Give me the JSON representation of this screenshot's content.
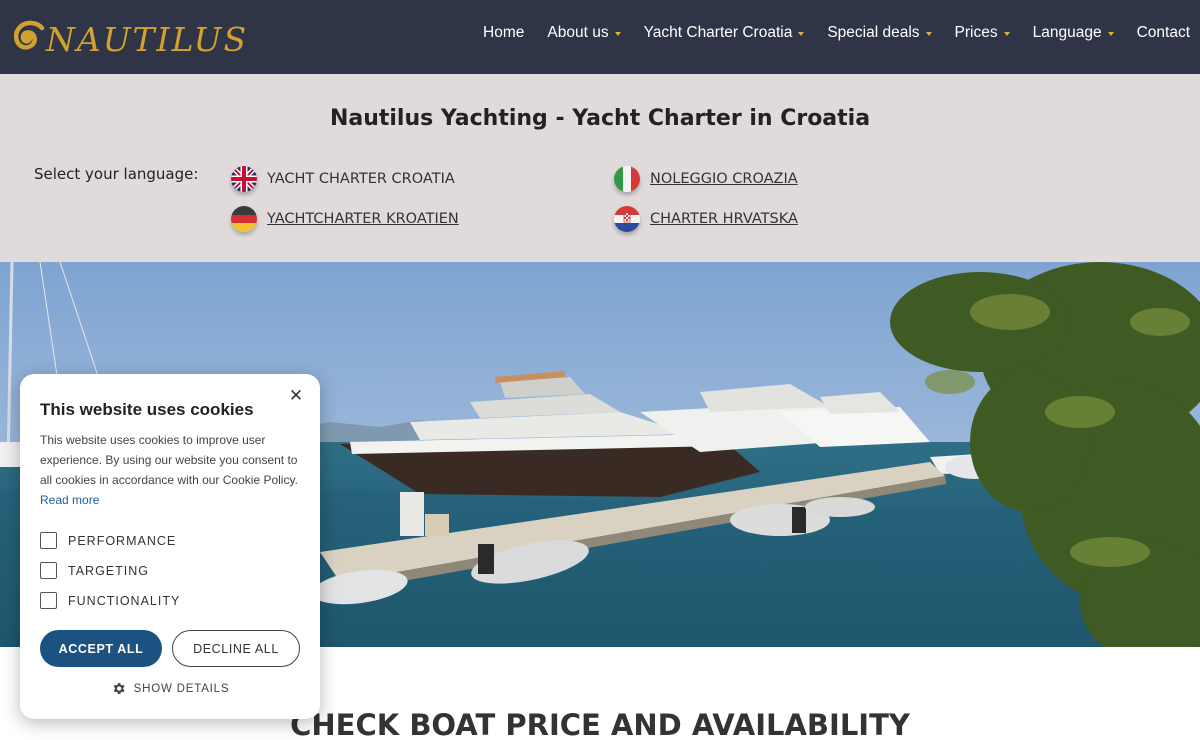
{
  "header": {
    "logo_text": "NAUTILUS",
    "nav": [
      {
        "label": "Home",
        "has_dropdown": false
      },
      {
        "label": "About us",
        "has_dropdown": true
      },
      {
        "label": "Yacht Charter Croatia",
        "has_dropdown": true
      },
      {
        "label": "Special deals",
        "has_dropdown": true
      },
      {
        "label": "Prices",
        "has_dropdown": true
      },
      {
        "label": "Language",
        "has_dropdown": true
      },
      {
        "label": "Contact",
        "has_dropdown": false
      }
    ]
  },
  "language_section": {
    "title": "Nautilus Yachting - Yacht Charter in Croatia",
    "select_label": "Select your language:",
    "languages": [
      {
        "label": "YACHT CHARTER CROATIA",
        "flag": "uk-flag-icon"
      },
      {
        "label": "NOLEGGIO CROAZIA",
        "flag": "italy-flag-icon"
      },
      {
        "label": "YACHTCHARTER KROATIEN",
        "flag": "germany-flag-icon"
      },
      {
        "label": "CHARTER HRVATSKA",
        "flag": "croatia-flag-icon"
      }
    ]
  },
  "hero": {
    "image": "marina-yachts-photo"
  },
  "main": {
    "section_title": "CHECK BOAT PRICE AND AVAILABILITY"
  },
  "cookie_dialog": {
    "title": "This website uses cookies",
    "body": "This website uses cookies to improve user experience. By using our website you consent to all cookies in accordance with our Cookie Policy.",
    "read_more": "Read more",
    "options": [
      "PERFORMANCE",
      "TARGETING",
      "FUNCTIONALITY"
    ],
    "accept_label": "ACCEPT ALL",
    "decline_label": "DECLINE ALL",
    "details_label": "SHOW DETAILS"
  },
  "colors": {
    "header_bg": "#2f3446",
    "logo_gold": "#d2a22e",
    "band_bg": "#e0dadb",
    "accept_bg": "#1c5282",
    "link_blue": "#1f5fa0"
  }
}
